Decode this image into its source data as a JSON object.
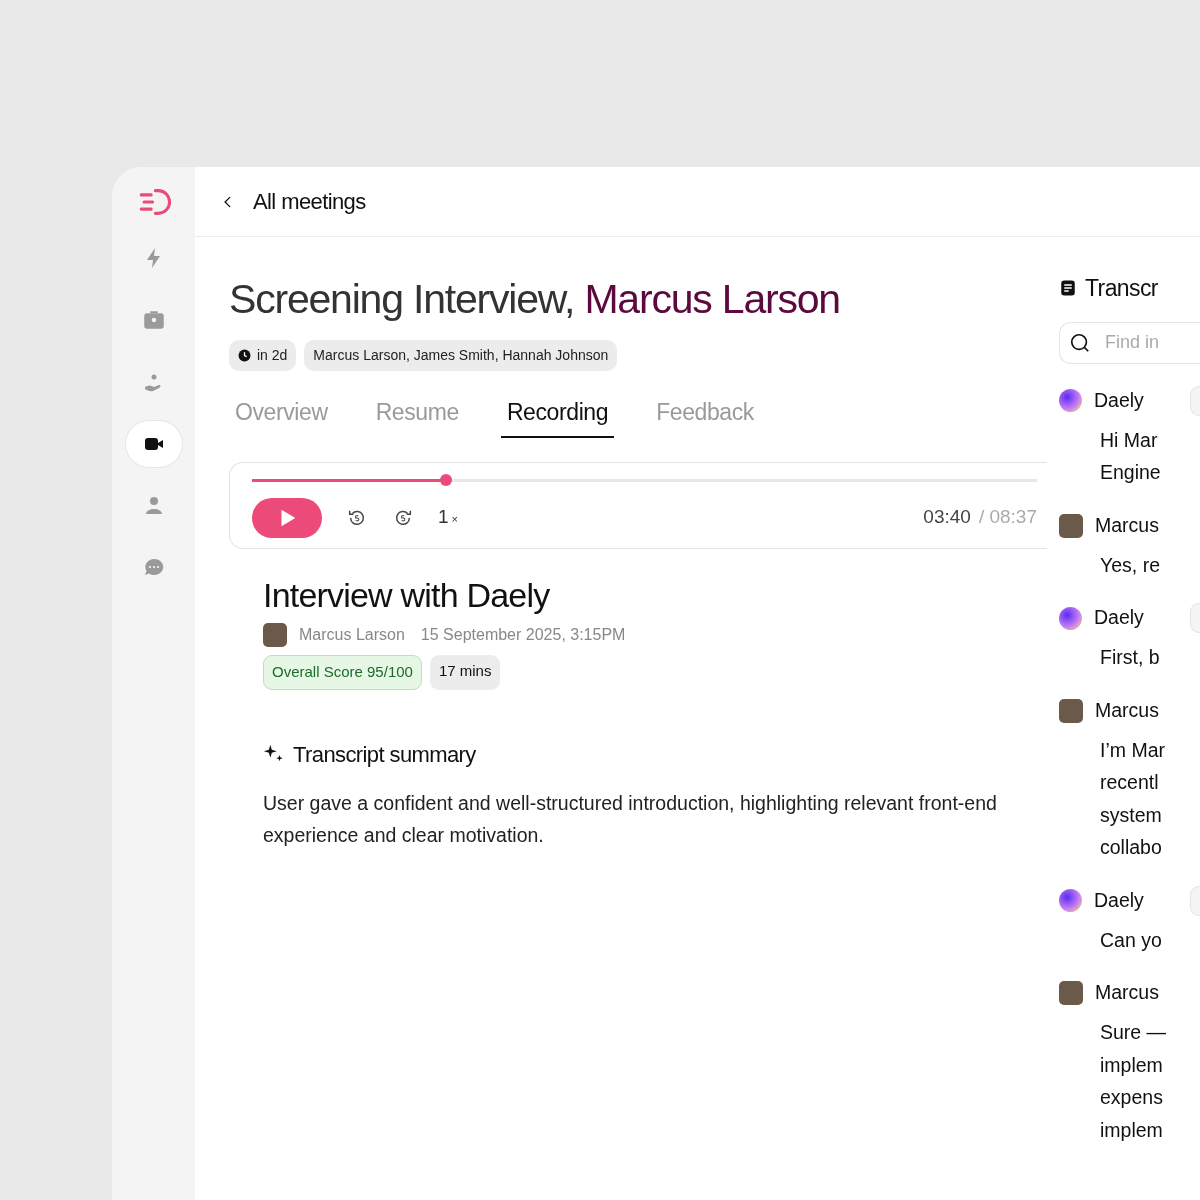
{
  "sidebar": {
    "items": [
      {
        "kind": "bolt",
        "selected": false
      },
      {
        "kind": "briefcase",
        "selected": false
      },
      {
        "kind": "hand",
        "selected": false
      },
      {
        "kind": "video",
        "selected": true
      },
      {
        "kind": "person",
        "selected": false
      },
      {
        "kind": "chat",
        "selected": false
      }
    ]
  },
  "header": {
    "back_label": "All meetings"
  },
  "meeting": {
    "title": "Screening Interview,",
    "title_name": "Marcus Larson",
    "when": "in 2d",
    "participants": "Marcus Larson, James Smith, Hannah Johnson"
  },
  "tabs": [
    {
      "label": "Overview",
      "selected": false
    },
    {
      "label": "Resume",
      "selected": false
    },
    {
      "label": "Recording",
      "selected": true
    },
    {
      "label": "Feedback",
      "selected": false
    }
  ],
  "player": {
    "level": 0.247,
    "speed": "1",
    "speed_unit": "×",
    "current": "03:40",
    "total": "/ 08:37"
  },
  "interview": {
    "title": "Interview with Daely",
    "author": "Marcus Larson",
    "date": "15 September 2025, 3:15PM",
    "score": "Overall Score 95/100",
    "duration": "17 mins"
  },
  "summary": {
    "title": "Transcript summary",
    "text": "User gave a confident and well-structured introduction, highlighting relevant front-end experience and clear motivation."
  },
  "transcript": {
    "title": "Transcr",
    "search_placeholder": "Find in",
    "entries": [
      {
        "kind": "ai",
        "speaker": "Daely",
        "lines": [
          "Hi Mar",
          "Engine"
        ]
      },
      {
        "kind": "person",
        "speaker": "Marcus",
        "lines": [
          "Yes, re"
        ]
      },
      {
        "kind": "ai",
        "speaker": "Daely",
        "lines": [
          "First, b"
        ]
      },
      {
        "kind": "person",
        "speaker": "Marcus",
        "lines": [
          "I’m Mar",
          "recentl",
          "system",
          "collabo"
        ]
      },
      {
        "kind": "ai",
        "speaker": "Daely",
        "lines": [
          "Can yo"
        ]
      },
      {
        "kind": "person",
        "speaker": "Marcus",
        "lines": [
          "Sure —",
          "implem",
          "expens",
          "implem"
        ]
      }
    ]
  }
}
